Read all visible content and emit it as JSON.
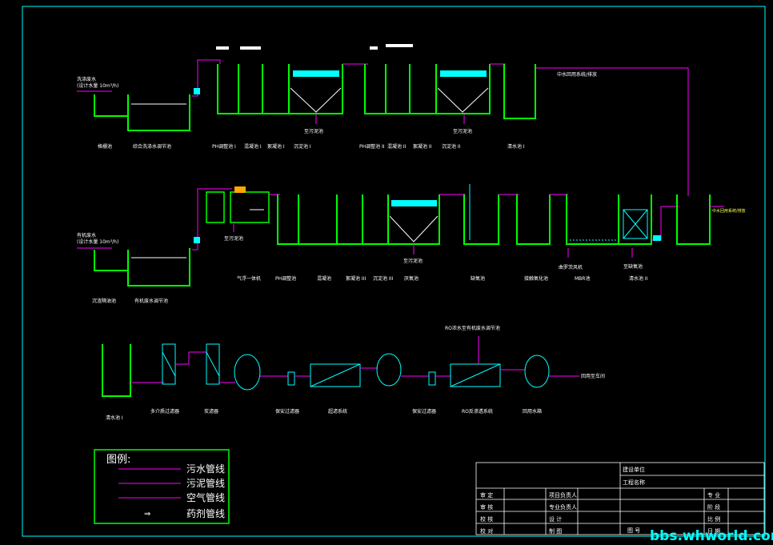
{
  "colors": {
    "background": "#000000",
    "frame": "#00ffff",
    "tank": "#00ff00",
    "sewage_pipe": "#ff00ff",
    "text": "#ffffff",
    "sludge_hopper": "#00ffff"
  },
  "row1": {
    "inlet_note": "洗涤废水\n(设计水量 10m³/h)",
    "labels": [
      "格栅池",
      "综合洗涤水调节池",
      "PH调整池 I",
      "混凝池 I",
      "絮凝池 I",
      "沉淀池 I",
      "PH调整池 II",
      "混凝池 II",
      "絮凝池 II",
      "沉淀池 II",
      "清水池 I"
    ],
    "sludge_1": "至污泥池",
    "sludge_2": "至污泥池",
    "reuse_note": "中水回用系统/排放"
  },
  "row2": {
    "inlet_note": "有机废水\n(设计水量 10m³/h)",
    "labels": [
      "沉渣隔油池",
      "有机废水调节池",
      "气浮一体机",
      "PH调整池",
      "混凝池",
      "絮凝池 III",
      "沉淀池 III",
      "厌氧池",
      "缺氧池",
      "接触氧化池",
      "MBR池",
      "清水池 II"
    ],
    "sludge_float": "至污泥池",
    "sludge_3": "至污泥池",
    "blower": "曲罗茨风机",
    "sludge_return": "至缺氧池",
    "discharge": "中水回用系统/排放"
  },
  "row3": {
    "labels": [
      "清水池 I",
      "多介质过滤器",
      "炭滤器",
      "保安过滤器",
      "超滤系统",
      "保安过滤器",
      "RO反渗透系统",
      "回用水箱"
    ],
    "ro_reject": "RO浓水至有机废水调节池",
    "reuse_target": "回用至车间"
  },
  "legend": {
    "title": "图例:",
    "items": [
      "污水管线",
      "污泥管线",
      "空气管线",
      "药剂管线"
    ]
  },
  "title_block": {
    "rows_left": [
      [
        "审 定",
        "项目负责人"
      ],
      [
        "审 核",
        "专业负责人"
      ],
      [
        "校 核",
        "设 计"
      ],
      [
        "校 对",
        "制 图"
      ]
    ],
    "rows_right": [
      "专 业",
      "阶 段",
      "比 例",
      "日 期"
    ],
    "top": [
      "建设单位",
      "工程名称"
    ],
    "drawing_no": "图 号"
  },
  "watermark": "bbs.whworld.com"
}
